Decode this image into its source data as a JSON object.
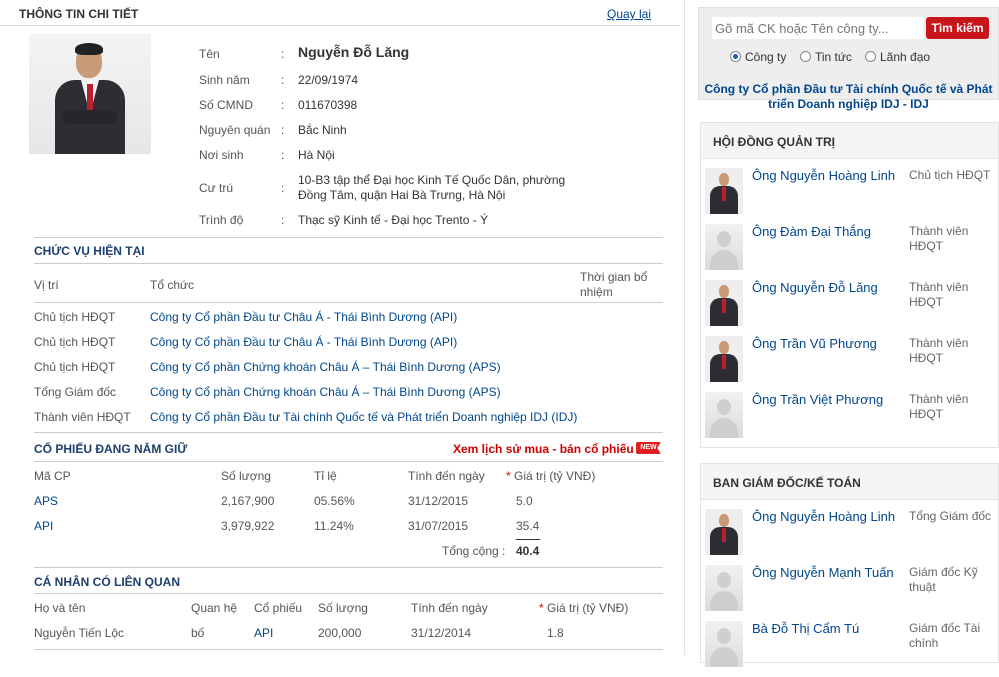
{
  "header": {
    "title": "THÔNG TIN CHI TIẾT",
    "back_label": "Quay lại"
  },
  "profile": {
    "rows": [
      {
        "label": "Tên",
        "value": "Nguyễn Đỗ Lăng"
      },
      {
        "label": "Sinh năm",
        "value": "22/09/1974"
      },
      {
        "label": "Số CMND",
        "value": "011670398"
      },
      {
        "label": "Nguyên quán",
        "value": "Bắc Ninh"
      },
      {
        "label": "Nơi sinh",
        "value": "Hà Nội"
      },
      {
        "label": "Cư trú",
        "value": "10-B3 tập thể Đại học Kinh Tế Quốc Dân, phường Đồng Tâm, quận Hai Bà Trưng, Hà Nội"
      },
      {
        "label": "Trình độ",
        "value": "Thạc sỹ Kinh tế - Đại học Trento - Ý"
      }
    ]
  },
  "positions": {
    "title": "CHỨC VỤ HIỆN TẠI",
    "headers": {
      "position": "Vị trí",
      "organization": "Tổ chức",
      "appointed": "Thời gian bổ nhiệm"
    },
    "rows": [
      {
        "position": "Chủ tịch HĐQT",
        "organization": "Công ty Cổ phần Đầu tư Châu Á - Thái Bình Dương (API)"
      },
      {
        "position": "Chủ tịch HĐQT",
        "organization": "Công ty Cổ phần Đầu tư Châu Á - Thái Bình Dương (API)"
      },
      {
        "position": "Chủ tịch HĐQT",
        "organization": "Công ty Cổ phần Chứng khoán Châu Á – Thái Bình Dương (APS)"
      },
      {
        "position": "Tổng Giám đốc",
        "organization": "Công ty Cổ phần Chứng khoán Châu Á – Thái Bình Dương (APS)"
      },
      {
        "position": "Thành viên HĐQT",
        "organization": "Công ty Cổ phần Đầu tư Tài chính Quốc tế và Phát triển Doanh nghiệp IDJ (IDJ)"
      }
    ]
  },
  "holdings": {
    "title": "CỔ PHIẾU ĐANG NẮM GIỮ",
    "history_link": "Xem lịch sử mua - bán cổ phiếu",
    "new_badge": "NEW",
    "headers": {
      "code": "Mã CP",
      "quantity": "Số lượng",
      "ratio": "Tỉ lệ",
      "as_of": "Tính đến ngày",
      "star": "*",
      "value": "Giá trị (tỷ VNĐ)"
    },
    "rows": [
      {
        "code": "APS",
        "quantity": "2,167,900",
        "ratio": "05.56%",
        "as_of": "31/12/2015",
        "value": "5.0"
      },
      {
        "code": "API",
        "quantity": "3,979,922",
        "ratio": "11.24%",
        "as_of": "31/07/2015",
        "value": "35.4"
      }
    ],
    "total_label": "Tổng cộng :",
    "total_value": "40.4"
  },
  "related": {
    "title": "CÁ NHÂN CÓ LIÊN QUAN",
    "headers": {
      "name": "Họ và tên",
      "relation": "Quan hệ",
      "stock": "Cổ phiếu",
      "quantity": "Số lượng",
      "as_of": "Tính đến ngày",
      "star": "*",
      "value": "Giá trị (tỷ VNĐ)"
    },
    "rows": [
      {
        "name": "Nguyễn Tiến Lộc",
        "relation": "bố",
        "stock": "API",
        "quantity": "200,000",
        "as_of": "31/12/2014",
        "value": "1.8"
      }
    ]
  },
  "search": {
    "placeholder": "Gõ mã CK hoặc Tên công ty...",
    "button": "Tìm kiếm",
    "options": [
      "Công ty",
      "Tin tức",
      "Lãnh đạo"
    ],
    "selected": "Công ty",
    "company": "Công ty Cổ phần Đầu tư Tài chính Quốc tế và Phát triển Doanh nghiệp IDJ - IDJ"
  },
  "board": {
    "title": "HỘI ĐỒNG QUẢN TRỊ",
    "members": [
      {
        "name": "Ông Nguyễn Hoàng Linh",
        "role": "Chủ tịch HĐQT",
        "photo": true
      },
      {
        "name": "Ông Đàm Đại Thắng",
        "role": "Thành viên HĐQT",
        "photo": false
      },
      {
        "name": "Ông Nguyễn Đỗ Lăng",
        "role": "Thành viên HĐQT",
        "photo": true
      },
      {
        "name": "Ông Trần Vũ Phương",
        "role": "Thành viên HĐQT",
        "photo": true
      },
      {
        "name": "Ông Trần Việt Phương",
        "role": "Thành viên HĐQT",
        "photo": false
      }
    ]
  },
  "management": {
    "title": "BAN GIÁM ĐỐC/KẾ TOÁN",
    "members": [
      {
        "name": "Ông Nguyễn Hoàng Linh",
        "role": "Tổng Giám đốc",
        "photo": true
      },
      {
        "name": "Ông Nguyễn Mạnh Tuấn",
        "role": "Giám đốc Kỹ thuật",
        "photo": false
      },
      {
        "name": "Bà Đỗ Thị Cẩm Tú",
        "role": "Giám đốc Tài chính",
        "photo": false
      }
    ]
  }
}
